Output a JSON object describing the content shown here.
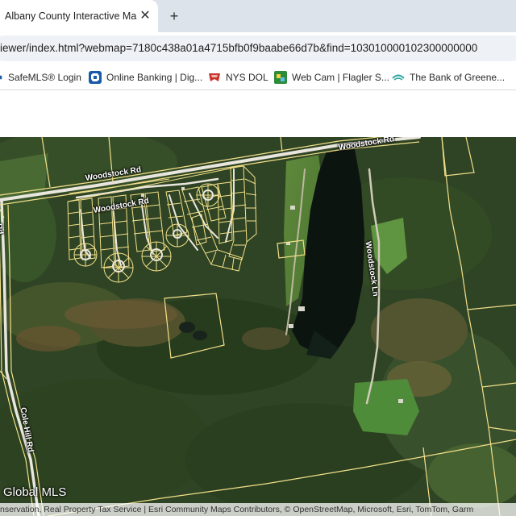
{
  "browser": {
    "tab": {
      "title": "Albany County Interactive Map",
      "close": "✕"
    },
    "new_tab": "+",
    "url": "iewer/index.html?webmap=7180c438a01a4715bfb0f9baabe66d7b&find=103010000102300000000"
  },
  "bookmarks": [
    {
      "label": "SafeMLS® Login",
      "icon": "safemls-icon"
    },
    {
      "label": "Online Banking | Dig...",
      "icon": "chase-icon"
    },
    {
      "label": "NYS DOL",
      "icon": "nys-dol-icon"
    },
    {
      "label": "Web Cam | Flagler S...",
      "icon": "webcam-icon"
    },
    {
      "label": "The Bank of Greene...",
      "icon": "bank-icon"
    }
  ],
  "map": {
    "roads": {
      "woodstock_rd_north": "Woodstock Rd",
      "woodstock_rd_west": "Woodstock Rd",
      "woodstock_rd_inner": "Woodstock Rd",
      "woodstock_ln": "Woodstock Ln",
      "cole_hill_rd": "Cole Hill Rd",
      "edge_rd": "Rd"
    },
    "watermark": "Global MLS",
    "attribution": "nservation, Real Property Tax Service | Esri Community Maps Contributors, © OpenStreetMap, Microsoft, Esri, TomTom, Garm",
    "colors": {
      "parcel_line": "#f3e08a",
      "water": "#0c140f",
      "forest": "#2f4424",
      "road": "#e9e6de"
    }
  }
}
